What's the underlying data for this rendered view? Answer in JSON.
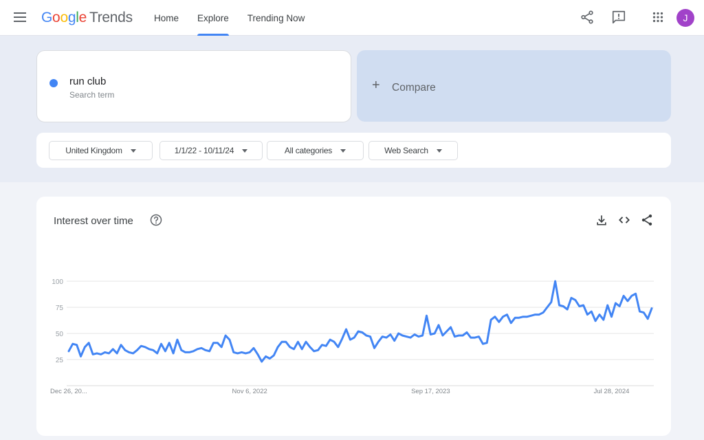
{
  "app": {
    "logo_parts": [
      "G",
      "o",
      "o",
      "g",
      "l",
      "e"
    ],
    "logo_suffix": "Trends",
    "user_initial": "J",
    "avatar_color": "#a142c9",
    "accent": "#4285f4"
  },
  "nav": {
    "items": [
      {
        "label": "Home",
        "active": false
      },
      {
        "label": "Explore",
        "active": true
      },
      {
        "label": "Trending Now",
        "active": false
      }
    ]
  },
  "header_icons": [
    "menu-icon",
    "share-icon",
    "feedback-icon",
    "apps-icon"
  ],
  "search": {
    "term": "run club",
    "term_subtitle": "Search term",
    "term_color": "#4285f4",
    "compare_label": "Compare"
  },
  "filters": [
    {
      "label": "United Kingdom"
    },
    {
      "label": "1/1/22 - 10/11/24"
    },
    {
      "label": "All categories"
    },
    {
      "label": "Web Search"
    }
  ],
  "interest_panel": {
    "title": "Interest over time",
    "actions": [
      "download-icon",
      "embed-icon",
      "share-icon"
    ]
  },
  "chart_data": {
    "type": "line",
    "title": "Interest over time",
    "xlabel": "",
    "ylabel": "",
    "ylim": [
      0,
      100
    ],
    "yticks": [
      25,
      50,
      75,
      100
    ],
    "xtick_labels": [
      "Dec 26, 20...",
      "Nov 6, 2022",
      "Sep 17, 2023",
      "Jul 28, 2024"
    ],
    "xtick_index": [
      0,
      45,
      90,
      135
    ],
    "grid": true,
    "legend": "none",
    "series": [
      {
        "name": "run club",
        "color": "#4285f4",
        "values": [
          33,
          40,
          39,
          28,
          37,
          41,
          30,
          31,
          30,
          32,
          31,
          35,
          31,
          39,
          34,
          32,
          31,
          34,
          38,
          37,
          35,
          34,
          31,
          40,
          33,
          41,
          31,
          44,
          34,
          32,
          32,
          33,
          35,
          36,
          34,
          33,
          41,
          41,
          37,
          48,
          44,
          32,
          31,
          32,
          31,
          32,
          36,
          30,
          23,
          28,
          26,
          29,
          37,
          42,
          42,
          37,
          35,
          42,
          35,
          42,
          37,
          33,
          34,
          39,
          38,
          44,
          42,
          37,
          45,
          54,
          44,
          46,
          52,
          51,
          48,
          47,
          36,
          42,
          47,
          46,
          49,
          43,
          50,
          48,
          47,
          46,
          49,
          47,
          48,
          67,
          49,
          50,
          58,
          48,
          52,
          56,
          47,
          48,
          48,
          51,
          46,
          46,
          47,
          40,
          41,
          63,
          66,
          61,
          66,
          68,
          60,
          65,
          65,
          66,
          66,
          67,
          68,
          68,
          70,
          75,
          80,
          100,
          77,
          76,
          73,
          84,
          82,
          76,
          77,
          68,
          71,
          62,
          68,
          63,
          77,
          66,
          79,
          76,
          86,
          81,
          86,
          88,
          71,
          70,
          64,
          74
        ]
      }
    ]
  }
}
